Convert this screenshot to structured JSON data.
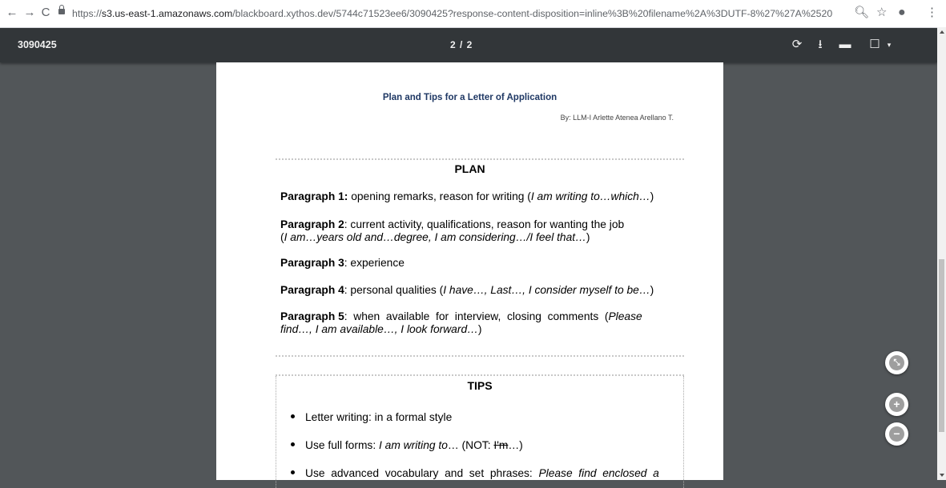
{
  "browser": {
    "url_prefix": "https://",
    "url_host": "s3.us-east-1.amazonaws.com",
    "url_path": "/blackboard.xythos.dev/5744c71523ee6/3090425?response-content-disposition=inline%3B%20filename%2A%3DUTF-8%27%27A%2520..."
  },
  "toolbar": {
    "title": "3090425",
    "page_indicator": "2 / 2"
  },
  "document": {
    "heading": "Plan and Tips for a Letter of Application",
    "author": "By: LLM-I Arlette Atenea Arellano T.",
    "plan_title": "PLAN",
    "p1_label": "Paragraph 1:",
    "p1_text": " opening remarks, reason for writing (",
    "p1_italic": "I am writing to…which…",
    "p1_end": ")",
    "p2_label": "Paragraph 2",
    "p2_text": ":  current activity, qualifications, reason for wanting the job",
    "p2_open": "(",
    "p2_italic": "I am…years old and…degree, I am considering…/I feel that…",
    "p2_end": ")",
    "p3_label": "Paragraph 3",
    "p3_text": ": experience",
    "p4_label": "Paragraph 4",
    "p4_text": ": personal qualities (",
    "p4_italic": "I have…, Last…, I consider myself to be…",
    "p4_end": ")",
    "p5_label": "Paragraph 5",
    "p5_text": ":  when  available  for  interview,  closing  comments  (",
    "p5_italic1": "Please",
    "p5_italic2": "find…, I am available…, I look forward…",
    "p5_end": ")",
    "tips_title": "TIPS",
    "tip1": "Letter writing: in a formal style",
    "tip2_a": "Use full forms: ",
    "tip2_italic": "I am writing to",
    "tip2_b": "… (NOT: ",
    "tip2_strike": "I'm",
    "tip2_c": "…)",
    "tip3_a": "Use  advanced  vocabulary  and  set  phrases:  ",
    "tip3_italic": "Please  find  enclosed  a"
  },
  "icons": {
    "back": "back-arrow-icon",
    "forward": "forward-arrow-icon",
    "reload": "reload-icon",
    "zoom": "magnifier-icon",
    "star": "star-icon",
    "account": "account-icon",
    "menu": "kebab-menu-icon",
    "rotate": "rotate-icon",
    "download": "download-icon",
    "print": "print-icon",
    "bookmark": "bookmark-icon",
    "fit": "fit-page-icon",
    "zoom_in": "zoom-in-icon",
    "zoom_out": "zoom-out-icon"
  },
  "colors": {
    "toolbar_bg": "#323639",
    "viewer_bg": "#525659",
    "heading": "#1f3864"
  }
}
